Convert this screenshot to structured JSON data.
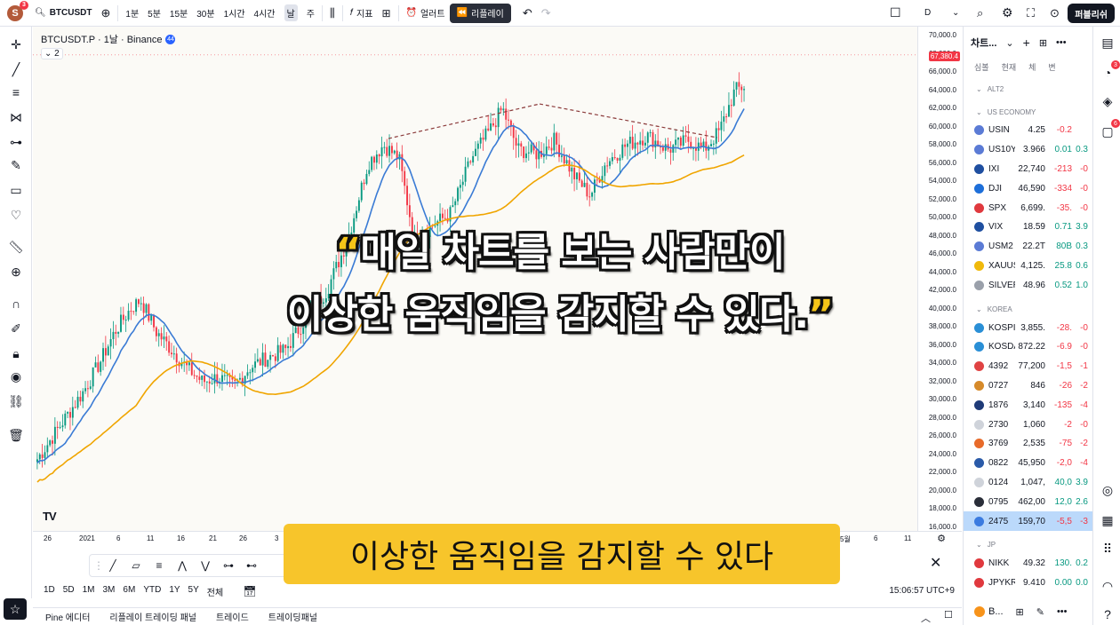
{
  "topbar": {
    "avatar_letter": "S",
    "avatar_badge": "3",
    "symbol": "BTCUSDT",
    "timeframes": [
      "1분",
      "5분",
      "15분",
      "30분",
      "1시간",
      "4시간",
      "날",
      "주"
    ],
    "indicators_label": "지표",
    "alerts_label": "얼러트",
    "replay_label": "리플레이",
    "layout_label": "D",
    "publish_label": "퍼블리쉬"
  },
  "legend": {
    "title": "BTCUSDT.P · 1날 · Binance",
    "badge": "44",
    "sub": "2"
  },
  "price_axis": {
    "labels": [
      "70,000.0",
      "68,000.0",
      "66,000.0",
      "64,000.0",
      "62,000.0",
      "60,000.0",
      "58,000.0",
      "56,000.0",
      "54,000.0",
      "52,000.0",
      "50,000.0",
      "48,000.0",
      "46,000.0",
      "44,000.0",
      "42,000.0",
      "40,000.0",
      "38,000.0",
      "36,000.0",
      "34,000.0",
      "32,000.0",
      "30,000.0",
      "28,000.0",
      "26,000.0",
      "24,000.0",
      "22,000.0",
      "20,000.0",
      "18,000.0",
      "16,000.0"
    ],
    "current_price": "67,380.4"
  },
  "time_axis": {
    "labels": [
      "26",
      "2021",
      "6",
      "11",
      "16",
      "21",
      "26",
      "3",
      "5월",
      "6",
      "11"
    ]
  },
  "captions": {
    "line1_open": "“",
    "line1": "매일 차트를 보는 사람만이",
    "line2": "이상한 움직임을 감지할 수 있다.",
    "line2_close": "”",
    "subtitle": "이상한 움직임을 감지할 수 있다"
  },
  "bottom_range": {
    "ranges": [
      "1D",
      "5D",
      "1M",
      "3M",
      "6M",
      "YTD",
      "1Y",
      "5Y",
      "전체"
    ],
    "clock": "15:06:57 UTC+9"
  },
  "bottom_tabs": [
    "Pine 에디터",
    "리플레이 트레이딩 패널",
    "트레이드",
    "트레이딩패널"
  ],
  "watchlist": {
    "title": "차트...",
    "columns": [
      "심볼",
      "현재",
      "체",
      "변"
    ],
    "sections": [
      {
        "name": "ALT2",
        "rows": []
      },
      {
        "name": "US ECONOMY",
        "rows": [
          {
            "sym": "USIN",
            "last": "4.25",
            "chg": "-0.2",
            "pct": "",
            "color": "#5b7bd5",
            "dir": "neg"
          },
          {
            "sym": "US10Y",
            "last": "3.966",
            "chg": "0.01",
            "pct": "0.3",
            "color": "#5b7bd5",
            "dir": "pos"
          },
          {
            "sym": "IXI",
            "last": "22,740",
            "chg": "-213",
            "pct": "-0",
            "color": "#1f4fa0",
            "dir": "neg"
          },
          {
            "sym": "DJI",
            "last": "46,590",
            "chg": "-334",
            "pct": "-0",
            "color": "#1e6fd9",
            "dir": "neg"
          },
          {
            "sym": "SPX",
            "last": "6,699.",
            "chg": "-35.",
            "pct": "-0",
            "color": "#e0393e",
            "dir": "neg"
          },
          {
            "sym": "VIX",
            "last": "18.59",
            "chg": "0.71",
            "pct": "3.9",
            "color": "#1f4fa0",
            "dir": "pos"
          },
          {
            "sym": "USM2",
            "last": "22.2T",
            "chg": "80B",
            "pct": "0.3",
            "color": "#5b7bd5",
            "dir": "pos"
          },
          {
            "sym": "XAUUS",
            "last": "4,125.",
            "chg": "25.8",
            "pct": "0.6",
            "color": "#f0b90b",
            "dir": "pos"
          },
          {
            "sym": "SILVER",
            "last": "48.96",
            "chg": "0.52",
            "pct": "1.0",
            "color": "#9aa0aa",
            "dir": "pos"
          }
        ]
      },
      {
        "name": "KOREA",
        "rows": [
          {
            "sym": "KOSPI",
            "last": "3,855.",
            "chg": "-28.",
            "pct": "-0",
            "color": "#2a8fd6",
            "dir": "neg"
          },
          {
            "sym": "KOSDA",
            "last": "872.22",
            "chg": "-6.9",
            "pct": "-0",
            "color": "#2a8fd6",
            "dir": "neg"
          },
          {
            "sym": "4392",
            "last": "77,200",
            "chg": "-1,5",
            "pct": "-1",
            "color": "#e04343",
            "dir": "neg"
          },
          {
            "sym": "0727",
            "last": "846",
            "chg": "-26",
            "pct": "-2",
            "color": "#d68a2a",
            "dir": "neg"
          },
          {
            "sym": "1876",
            "last": "3,140",
            "chg": "-135",
            "pct": "-4",
            "color": "#1f3b78",
            "dir": "neg"
          },
          {
            "sym": "2730",
            "last": "1,060",
            "chg": "-2",
            "pct": "-0",
            "color": "#cfd3da",
            "dir": "neg"
          },
          {
            "sym": "3769",
            "last": "2,535",
            "chg": "-75",
            "pct": "-2",
            "color": "#e86b2a",
            "dir": "neg"
          },
          {
            "sym": "0822",
            "last": "45,950",
            "chg": "-2,0",
            "pct": "-4",
            "color": "#2a5aa8",
            "dir": "neg"
          },
          {
            "sym": "0124",
            "last": "1,047,",
            "chg": "40,0",
            "pct": "3.9",
            "color": "#cfd3da",
            "dir": "pos"
          },
          {
            "sym": "0795",
            "last": "462,00",
            "chg": "12,0",
            "pct": "2.6",
            "color": "#2a2e39",
            "dir": "pos"
          },
          {
            "sym": "2475",
            "last": "159,70",
            "chg": "-5,5",
            "pct": "-3",
            "color": "#3b7be0",
            "dir": "neg",
            "selected": true
          }
        ]
      },
      {
        "name": "JP",
        "rows": [
          {
            "sym": "NIKK",
            "last": "49.32",
            "chg": "130.",
            "pct": "0.2",
            "color": "#e0393e",
            "dir": "pos"
          },
          {
            "sym": "JPYKR",
            "last": "9.410",
            "chg": "0.00",
            "pct": "0.0",
            "color": "#e0393e",
            "dir": "pos"
          }
        ]
      }
    ],
    "bottom_label": "B..."
  },
  "colors": {
    "up": "#089981",
    "down": "#f23645",
    "ma_fast": "#3a7bd5",
    "ma_slow": "#f0a500",
    "trendline": "#8b3a3a",
    "caption_quote": "#f5c518",
    "subtitle_bg": "#f7c52b"
  }
}
